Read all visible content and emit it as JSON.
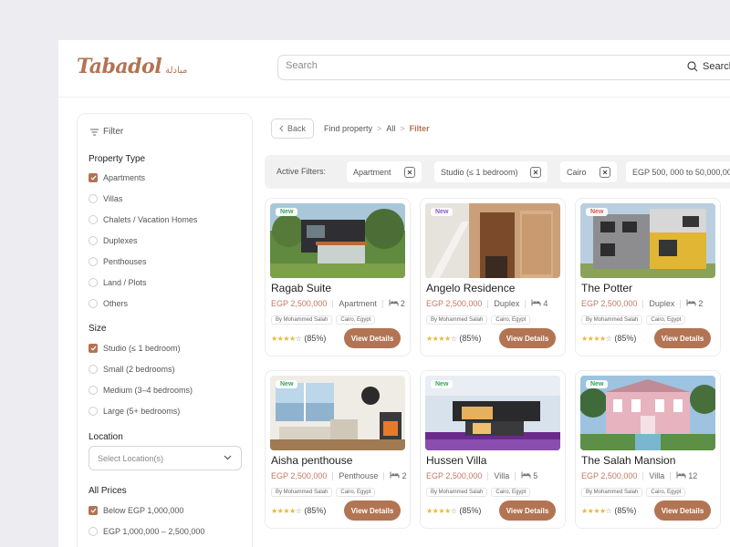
{
  "logo": {
    "text": "Tabadol",
    "arabic": "مبادلة"
  },
  "search": {
    "placeholder": "Search",
    "button_label": "Search"
  },
  "sidebar": {
    "filter_label": "Filter",
    "property_type": {
      "title": "Property Type",
      "options": [
        {
          "label": "Apartments",
          "checked": true
        },
        {
          "label": "Villas",
          "checked": false
        },
        {
          "label": "Chalets / Vacation Homes",
          "checked": false
        },
        {
          "label": "Duplexes",
          "checked": false
        },
        {
          "label": "Penthouses",
          "checked": false
        },
        {
          "label": "Land / Plots",
          "checked": false
        },
        {
          "label": "Others",
          "checked": false
        }
      ]
    },
    "size": {
      "title": "Size",
      "options": [
        {
          "label": "Studio (≤ 1 bedroom)",
          "checked": true
        },
        {
          "label": "Small (2 bedrooms)",
          "checked": false
        },
        {
          "label": "Medium (3–4 bedrooms)",
          "checked": false
        },
        {
          "label": "Large (5+ bedrooms)",
          "checked": false
        }
      ]
    },
    "location": {
      "title": "Location",
      "placeholder": "Select Location(s)"
    },
    "prices": {
      "title": "All Prices",
      "options": [
        {
          "label": "Below EGP 1,000,000",
          "checked": true
        },
        {
          "label": "EGP 1,000,000 – 2,500,000",
          "checked": false
        }
      ]
    }
  },
  "breadcrumb": {
    "back": "Back",
    "items": [
      "Find property",
      "All",
      "Filter"
    ]
  },
  "active_filters": {
    "label": "Active Filters:",
    "chips": [
      "Apartment",
      "Studio (≤ 1 bedroom)",
      "Cairo",
      "EGP 500, 000 to 50,000,000"
    ]
  },
  "colors": {
    "accent": "#b27453",
    "price": "#c07a62",
    "star": "#e8b93a",
    "new_badge_green": "#3aa55c",
    "new_badge_purple": "#8b5cc7",
    "new_badge_red": "#e0554a"
  },
  "view_details_label": "View Details",
  "listings": [
    {
      "title": "Ragab Suite",
      "price": "EGP 2,500,000",
      "type": "Apartment",
      "beds": "2",
      "owner": "By Mohammed Salah",
      "location": "Cairo, Egypt",
      "rating_text": "(85%)",
      "stars": 4,
      "badge": "New",
      "badge_color": "#3aa55c",
      "image": "modern-house-garden"
    },
    {
      "title": "Angelo Residence",
      "price": "EGP 2,500,000",
      "type": "Duplex",
      "beds": "4",
      "owner": "By Mohammed Salah",
      "location": "Cairo, Egypt",
      "rating_text": "(85%)",
      "stars": 4,
      "badge": "New",
      "badge_color": "#8b5cc7",
      "image": "wooden-interior-stairs"
    },
    {
      "title": "The Potter",
      "price": "EGP 2,500,000",
      "type": "Duplex",
      "beds": "2",
      "owner": "By Mohammed Salah",
      "location": "Cairo, Egypt",
      "rating_text": "(85%)",
      "stars": 4,
      "badge": "New",
      "badge_color": "#e0554a",
      "image": "colorful-facade"
    },
    {
      "title": "Aisha penthouse",
      "price": "EGP 2,500,000",
      "type": "Penthouse",
      "beds": "2",
      "owner": "By Mohammed Salah",
      "location": "Cairo, Egypt",
      "rating_text": "(85%)",
      "stars": 4,
      "badge": "New",
      "badge_color": "#3aa55c",
      "image": "living-room"
    },
    {
      "title": "Hussen Villa",
      "price": "EGP 2,500,000",
      "type": "Villa",
      "beds": "5",
      "owner": "By Mohammed Salah",
      "location": "Cairo, Egypt",
      "rating_text": "(85%)",
      "stars": 4,
      "badge": "New",
      "badge_color": "#3aa55c",
      "image": "cantilever-villa"
    },
    {
      "title": "The Salah Mansion",
      "price": "EGP 2,500,000",
      "type": "Villa",
      "beds": "12",
      "owner": "By Mohammed Salah",
      "location": "Cairo, Egypt",
      "rating_text": "(85%)",
      "stars": 4,
      "badge": "New",
      "badge_color": "#3aa55c",
      "image": "pink-mansion"
    }
  ]
}
